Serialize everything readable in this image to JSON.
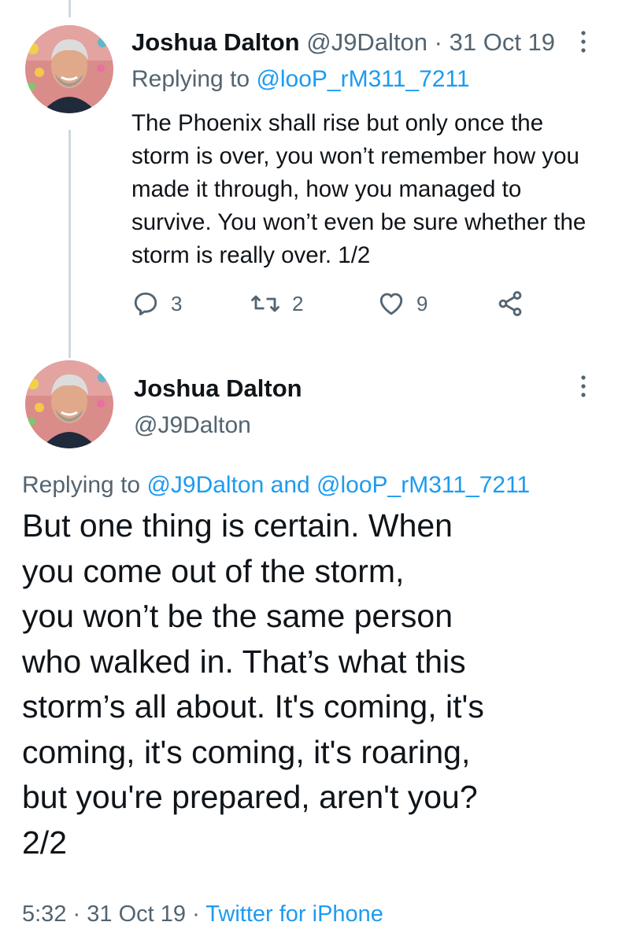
{
  "tweet1": {
    "name": "Joshua Dalton",
    "handle": "@J9Dalton",
    "separator": "·",
    "date": "31 Oct 19",
    "replying_prefix": "Replying to",
    "replying_to": "@looP_rM311_7211",
    "text": "The Phoenix shall rise but only once the storm is over, you won’t remember how you made it through, how you managed to survive. You won’t even be sure whether the storm is really over. 1/2",
    "actions": {
      "reply_icon": "comment-icon",
      "reply_count": "3",
      "retweet_icon": "retweet-icon",
      "retweet_count": "2",
      "like_icon": "heart-icon",
      "like_count": "9",
      "share_icon": "share-icon"
    }
  },
  "tweet2": {
    "name": "Joshua Dalton",
    "handle": "@J9Dalton",
    "replying_prefix": "Replying to",
    "replying_to_1": "@J9Dalton",
    "replying_and": "and",
    "replying_to_2": "@looP_rM311_7211",
    "text": "But one thing is certain. When\nyou come out of the storm,\nyou won’t be the same person\nwho walked in. That’s what this\nstorm’s all about. It's coming, it's\ncoming, it's coming, it's roaring,\nbut you're prepared, aren't you?\n2/2",
    "time": "5:32",
    "separator": "·",
    "date": "31 Oct 19",
    "separator2": "·",
    "source": "Twitter for iPhone"
  },
  "colors": {
    "text_primary": "#0f1419",
    "text_secondary": "#536471",
    "link": "#1d9bf0",
    "thread_line": "#cfd9de"
  }
}
